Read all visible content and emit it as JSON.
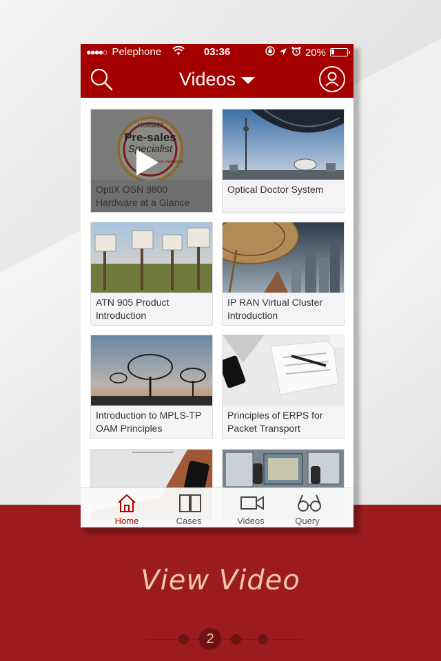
{
  "status_bar": {
    "signal": "●●●●○",
    "carrier": "Pelephone",
    "time": "03:36",
    "battery": "20%"
  },
  "nav": {
    "title": "Videos",
    "search_icon": "search-icon",
    "user_icon": "user-icon"
  },
  "videos": [
    {
      "title": "OptiX OSN 9800 Hardware at a Glance",
      "badge_top": "HUAWEI",
      "badge_main": "Pre-sales",
      "badge_sub": "Specialist",
      "badge_foot": "Transmission Network"
    },
    {
      "title": "Optical  Doctor System"
    },
    {
      "title": "ATN 905 Product Introduction"
    },
    {
      "title": "IP RAN Virtual Cluster Introduction"
    },
    {
      "title": "Introduction to MPLS-TP OAM Principles"
    },
    {
      "title": "Principles of ERPS for Packet Transport"
    },
    {
      "title": ""
    },
    {
      "title": ""
    }
  ],
  "tabs": [
    {
      "label": "Home",
      "icon": "home-icon"
    },
    {
      "label": "Cases",
      "icon": "book-icon"
    },
    {
      "label": "Videos",
      "icon": "video-camera-icon"
    },
    {
      "label": "Query",
      "icon": "glasses-icon"
    }
  ],
  "caption": "View Video",
  "pager": {
    "current": "2"
  },
  "colors": {
    "brand": "#a50000",
    "band": "#9b1b1f",
    "caption": "#f3c9a3"
  }
}
